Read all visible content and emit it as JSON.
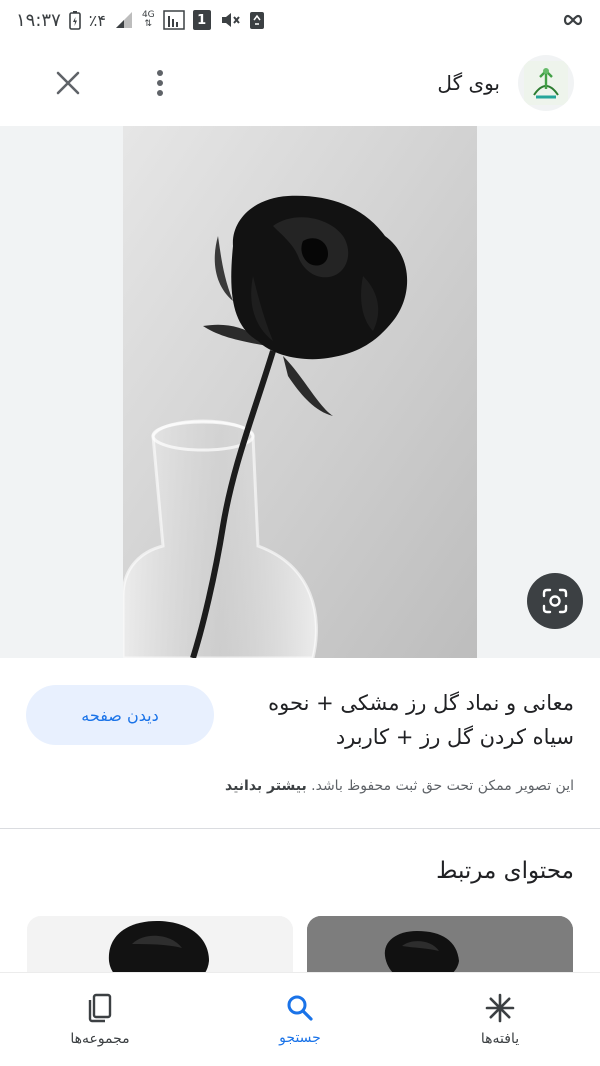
{
  "status_bar": {
    "time": "۱۹:۳۷",
    "battery": "٪۴",
    "network": "4G",
    "sim_slot": "1"
  },
  "header": {
    "site_name": "بوی گل",
    "icons": {
      "close": "close-icon",
      "menu": "more-vert-icon",
      "logo": "site-logo"
    }
  },
  "image": {
    "subject": "black rose in glass vase"
  },
  "details": {
    "title": "معانی و نماد گل رز مشکی + نحوه سیاه کردن گل رز + کاربرد",
    "visit_label": "دیدن صفحه",
    "copyright_text": "این تصویر ممکن تحت حق ثبت محفوظ باشد.",
    "learn_more": "بیشتر بدانید"
  },
  "related": {
    "heading": "محتوای مرتبط"
  },
  "bottom_nav": {
    "items": [
      {
        "label": "مجموعه‌ها",
        "icon": "collections-icon"
      },
      {
        "label": "جستجو",
        "icon": "search-icon",
        "active": true
      },
      {
        "label": "یافته‌ها",
        "icon": "discover-icon"
      }
    ]
  },
  "colors": {
    "accent": "#1a73e8",
    "button_bg": "#e8f0fe",
    "viewer_bg": "#f1f3f4"
  }
}
